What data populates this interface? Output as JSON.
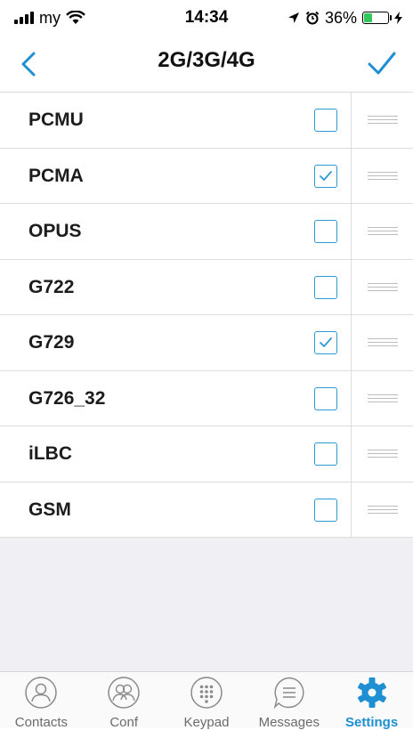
{
  "status_bar": {
    "carrier": "my",
    "time": "14:34",
    "battery": "36%",
    "battery_level": 0.36,
    "battery_color": "#34c759"
  },
  "nav": {
    "title": "2G/3G/4G",
    "back_icon": "chevron-left-icon",
    "done_icon": "checkmark-icon",
    "accent": "#1e8fd2"
  },
  "codecs": [
    {
      "label": "PCMU",
      "checked": false
    },
    {
      "label": "PCMA",
      "checked": true
    },
    {
      "label": "OPUS",
      "checked": false
    },
    {
      "label": "G722",
      "checked": false
    },
    {
      "label": "G729",
      "checked": true
    },
    {
      "label": "G726_32",
      "checked": false
    },
    {
      "label": "iLBC",
      "checked": false
    },
    {
      "label": "GSM",
      "checked": false
    }
  ],
  "tabs": [
    {
      "label": "Contacts",
      "icon": "contacts-icon",
      "active": false
    },
    {
      "label": "Conf",
      "icon": "conference-icon",
      "active": false
    },
    {
      "label": "Keypad",
      "icon": "keypad-icon",
      "active": false
    },
    {
      "label": "Messages",
      "icon": "messages-icon",
      "active": false
    },
    {
      "label": "Settings",
      "icon": "gear-icon",
      "active": true
    }
  ]
}
